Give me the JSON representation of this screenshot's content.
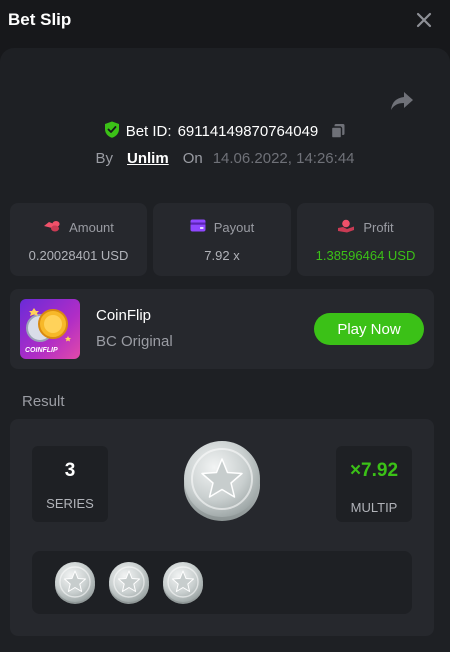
{
  "header": {
    "title": "Bet Slip",
    "close_icon": "close-icon"
  },
  "bet": {
    "id_label": "Bet ID:",
    "id_value": "69114149870764049",
    "by_label": "By",
    "user": "Unlim",
    "on_label": "On",
    "datetime": "14.06.2022, 14:26:44"
  },
  "stats": {
    "amount": {
      "label": "Amount",
      "value": "0.20028401 USD",
      "icon": "coins-icon",
      "color": "#f0516a"
    },
    "payout": {
      "label": "Payout",
      "value": "7.92 x",
      "icon": "card-icon",
      "color": "#8f47ff"
    },
    "profit": {
      "label": "Profit",
      "value": "1.38596464 USD",
      "icon": "hand-coin-icon",
      "color": "#f0516a"
    }
  },
  "game": {
    "name": "CoinFlip",
    "provider": "BC Original",
    "thumb_text": "COINFLIP",
    "play_label": "Play Now"
  },
  "result": {
    "title": "Result",
    "series_value": "3",
    "series_label": "SERIES",
    "multiplier_value": "×7.92",
    "multiplier_label": "MULTIP",
    "history": [
      "silver-star-coin",
      "silver-star-coin",
      "silver-star-coin"
    ]
  },
  "colors": {
    "accent_green": "#3bc117",
    "panel_bg": "#1e2024",
    "card_bg": "#26282d",
    "page_bg": "#17181b"
  }
}
